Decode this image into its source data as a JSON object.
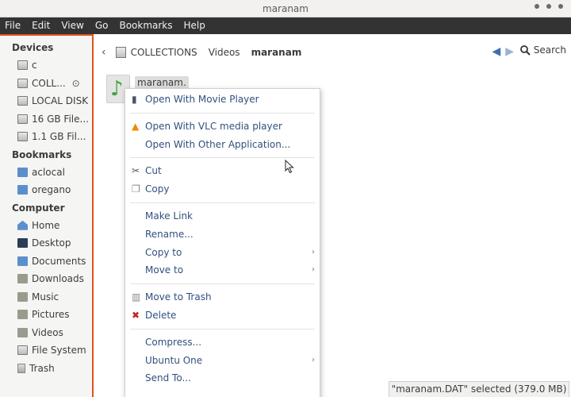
{
  "window": {
    "title": "maranam"
  },
  "menubar": {
    "items": [
      "File",
      "Edit",
      "View",
      "Go",
      "Bookmarks",
      "Help"
    ]
  },
  "sidebar": {
    "devices_heading": "Devices",
    "devices": [
      {
        "label": "c",
        "icon": "drive-icon"
      },
      {
        "label": "COLL...",
        "icon": "drive-icon",
        "eject": true
      },
      {
        "label": "LOCAL DISK",
        "icon": "drive-icon"
      },
      {
        "label": "16 GB File...",
        "icon": "drive-icon"
      },
      {
        "label": "1.1 GB Fil...",
        "icon": "drive-icon"
      }
    ],
    "bookmarks_heading": "Bookmarks",
    "bookmarks": [
      {
        "label": "aclocal",
        "icon": "folder-icon"
      },
      {
        "label": "oregano",
        "icon": "folder-icon"
      }
    ],
    "computer_heading": "Computer",
    "computer": [
      {
        "label": "Home",
        "icon": "home-icon"
      },
      {
        "label": "Desktop",
        "icon": "desktop-icon"
      },
      {
        "label": "Documents",
        "icon": "folder-icon"
      },
      {
        "label": "Downloads",
        "icon": "folder-icon"
      },
      {
        "label": "Music",
        "icon": "folder-icon"
      },
      {
        "label": "Pictures",
        "icon": "folder-icon"
      },
      {
        "label": "Videos",
        "icon": "folder-icon"
      },
      {
        "label": "File System",
        "icon": "drive-icon"
      },
      {
        "label": "Trash",
        "icon": "trash-icon"
      }
    ]
  },
  "pathbar": {
    "crumbs": [
      "COLLECTIONS",
      "Videos",
      "maranam"
    ],
    "search_label": "Search"
  },
  "file": {
    "label": "maranam."
  },
  "context_menu": {
    "open_movie_player": "Open With Movie Player",
    "open_vlc": "Open With VLC media player",
    "open_other": "Open With Other Application...",
    "cut": "Cut",
    "copy": "Copy",
    "make_link": "Make Link",
    "rename": "Rename...",
    "copy_to": "Copy to",
    "move_to": "Move to",
    "move_to_trash": "Move to Trash",
    "delete": "Delete",
    "compress": "Compress...",
    "ubuntu_one": "Ubuntu One",
    "send_to": "Send To..."
  },
  "status": {
    "text": "\"maranam.DAT\" selected (379.0 MB)"
  },
  "colors": {
    "accent": "#e0531f",
    "menubar": "#333333",
    "menu_text": "#30507e"
  }
}
